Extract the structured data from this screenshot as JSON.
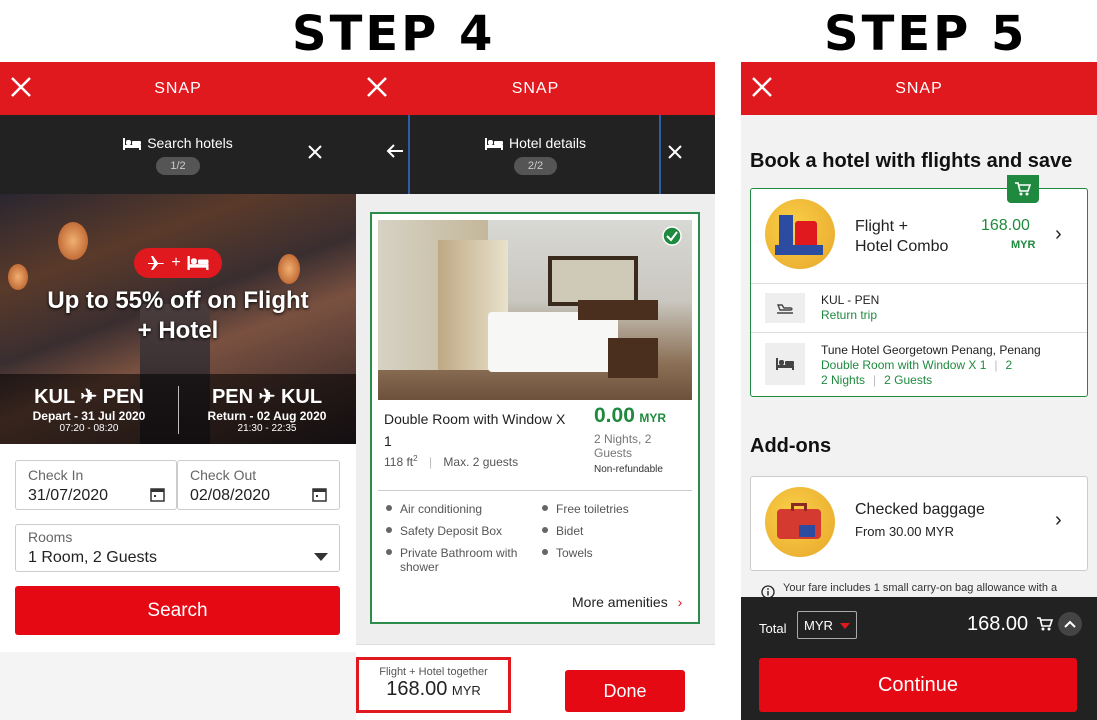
{
  "steps": {
    "step4": "STEP 4",
    "step5": "STEP 5"
  },
  "app": {
    "title": "SNAP"
  },
  "search_panel": {
    "header": "Search hotels",
    "page": "1/2",
    "promo": "Up to 55% off on Flight + Hotel",
    "outbound": {
      "codes": [
        "KUL",
        "PEN"
      ],
      "date": "Depart - 31 Jul 2020",
      "time": "07:20 - 08:20"
    },
    "return": {
      "codes": [
        "PEN",
        "KUL"
      ],
      "date": "Return - 02 Aug 2020",
      "time": "21:30 - 22:35"
    },
    "check_in": {
      "label": "Check In",
      "value": "31/07/2020"
    },
    "check_out": {
      "label": "Check Out",
      "value": "02/08/2020"
    },
    "rooms": {
      "label": "Rooms",
      "value": "1 Room, 2 Guests"
    },
    "search_button": "Search"
  },
  "details_panel": {
    "header": "Hotel details",
    "page": "2/2",
    "room_name": "Double Room with Window X 1",
    "price": "0.00",
    "currency": "MYR",
    "nights_guests": "2 Nights, 2 Guests",
    "refund": "Non-refundable",
    "size": "118 ft",
    "size_sup": "2",
    "max_guests": "Max. 2 guests",
    "amenities": [
      "Air conditioning",
      "Free toiletries",
      "Safety Deposit Box",
      "Bidet",
      "Private Bathroom with shower",
      "Towels"
    ],
    "more": "More amenities",
    "footer_label": "Flight + Hotel together",
    "footer_price": "168.00",
    "footer_currency": "MYR",
    "done_button": "Done"
  },
  "summary_panel": {
    "heading": "Book a hotel with flights and save",
    "combo_label_1": "Flight +",
    "combo_label_2": "Hotel Combo",
    "combo_price": "168.00",
    "combo_currency": "MYR",
    "flight_route": "KUL - PEN",
    "flight_type": "Return trip",
    "hotel_name": "Tune Hotel Georgetown Penang, Penang",
    "hotel_room": "Double Room with Window X 1",
    "hotel_nights": "2 Nights",
    "hotel_guests": "2 Guests",
    "addons_heading": "Add-ons",
    "baggage_title": "Checked baggage",
    "baggage_from": "From 30.00 MYR",
    "fare_note": "Your fare includes 1 small carry-on bag allowance with a",
    "total_label": "Total",
    "currency_select": "MYR",
    "total_price": "168.00",
    "continue_button": "Continue"
  },
  "colors": {
    "brand_red": "#e0191f",
    "accent_green": "#1f8a3f",
    "dark": "#222222"
  }
}
